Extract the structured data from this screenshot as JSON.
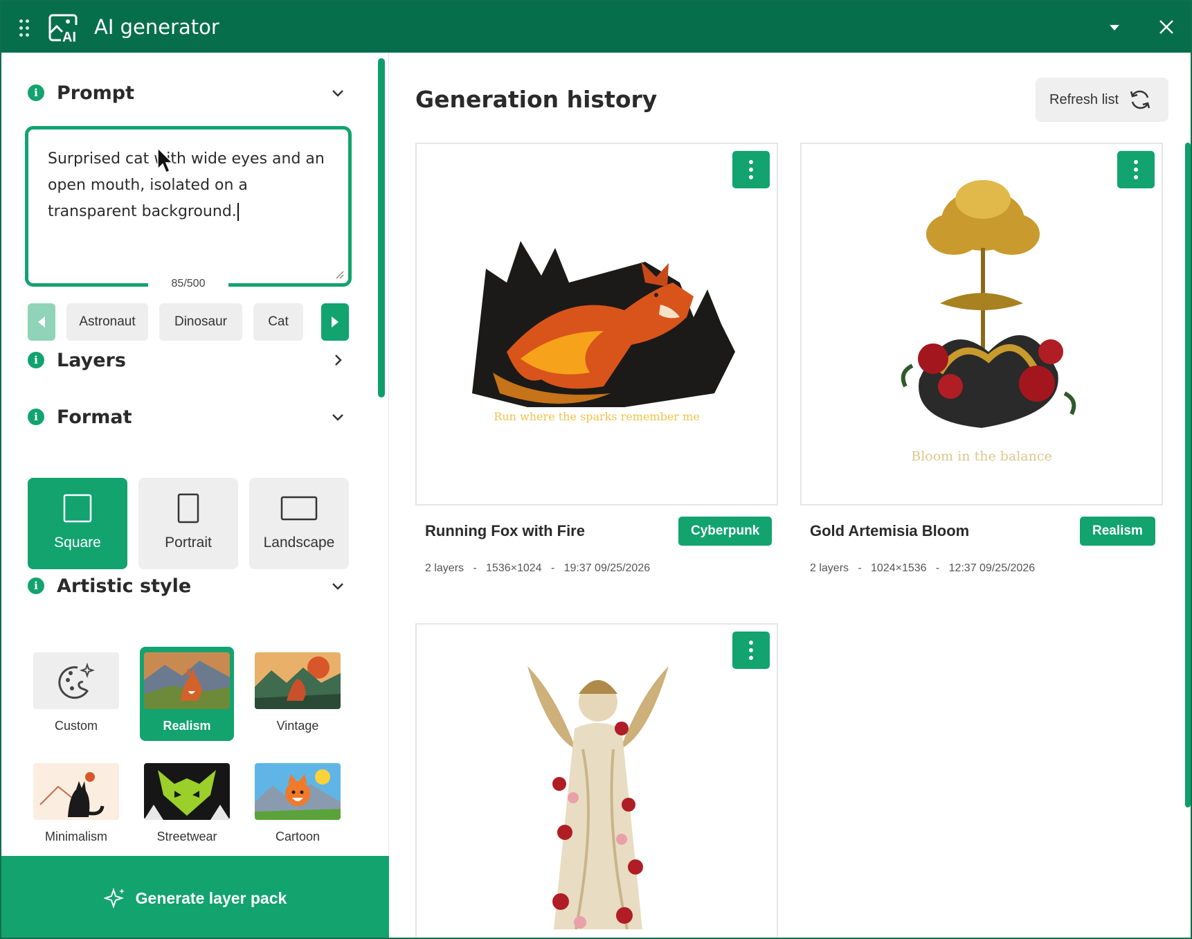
{
  "app": {
    "title": "AI generator"
  },
  "prompt": {
    "heading": "Prompt",
    "text": "Surprised cat with wide eyes and an open mouth, isolated on a transparent background.",
    "char_count": "85/500",
    "suggestions": [
      "Astronaut",
      "Dinosaur",
      "Cat"
    ]
  },
  "layers": {
    "heading": "Layers"
  },
  "format": {
    "heading": "Format",
    "options": [
      {
        "label": "Square",
        "selected": true
      },
      {
        "label": "Portrait",
        "selected": false
      },
      {
        "label": "Landscape",
        "selected": false
      }
    ]
  },
  "artistic_style": {
    "heading": "Artistic style",
    "options": [
      {
        "label": "Custom",
        "selected": false
      },
      {
        "label": "Realism",
        "selected": true
      },
      {
        "label": "Vintage",
        "selected": false
      },
      {
        "label": "Minimalism",
        "selected": false
      },
      {
        "label": "Streetwear",
        "selected": false
      },
      {
        "label": "Cartoon",
        "selected": false
      }
    ]
  },
  "generate": {
    "label": "Generate layer pack"
  },
  "history": {
    "title": "Generation history",
    "refresh_label": "Refresh list",
    "cards": [
      {
        "title": "Running Fox with Fire",
        "tag": "Cyberpunk",
        "layers": "2 layers",
        "size": "1536×1024",
        "datetime": "19:37 09/25/2026",
        "image_caption": "Run where the sparks remember me"
      },
      {
        "title": "Gold Artemisia Bloom",
        "tag": "Realism",
        "layers": "2 layers",
        "size": "1024×1536",
        "datetime": "12:37 09/25/2026",
        "image_caption": "Bloom in the balance"
      },
      {
        "title": "",
        "tag": "",
        "layers": "",
        "size": "",
        "datetime": "",
        "image_caption": ""
      }
    ]
  },
  "colors": {
    "brand": "#076e4c",
    "accent": "#12a36f",
    "accent_light": "#8fd3b9",
    "chip_bg": "#eeeeee"
  },
  "icons": {
    "drag": "grid-dots-icon",
    "app": "ai-image-icon",
    "dropdown": "caret-down-icon",
    "close": "close-icon",
    "info": "info-icon",
    "refresh": "refresh-icon",
    "more": "kebab-icon",
    "sparkle": "sparkle-icon"
  }
}
